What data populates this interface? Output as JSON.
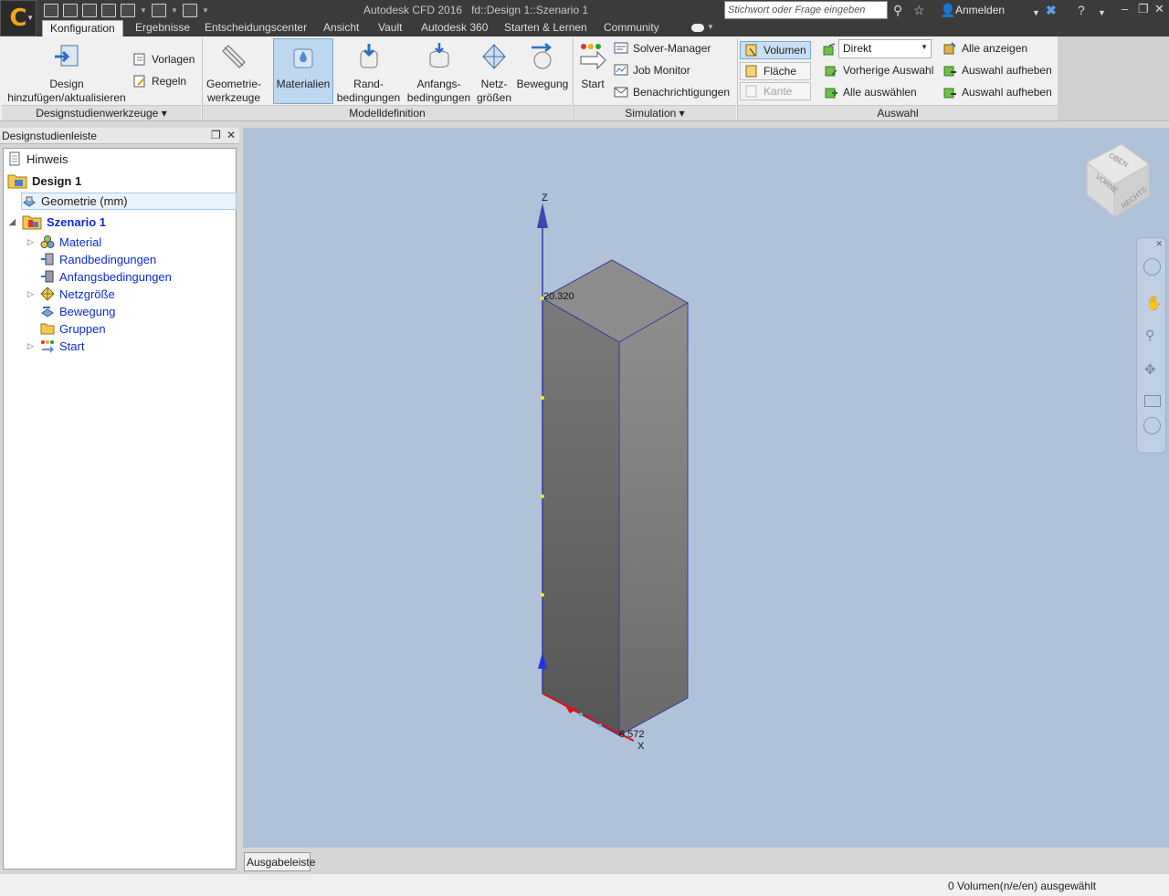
{
  "window": {
    "title": "Autodesk CFD 2016",
    "subtitle": "fd::Design 1::Szenario 1",
    "search_placeholder": "Stichwort oder Frage eingeben",
    "signin_label": "Anmelden"
  },
  "tabs": [
    "Konfiguration",
    "Ergebnisse",
    "Entscheidungscenter",
    "Ansicht",
    "Vault",
    "Autodesk 360",
    "Starten & Lernen",
    "Community"
  ],
  "ribbon": {
    "design_tools": {
      "add_design": "Design hinzufügen/aktualisieren",
      "add_design_l1": "Design",
      "add_design_l2": "hinzufügen/aktualisieren",
      "templates": "Vorlagen",
      "rules": "Regeln",
      "panel_label": "Designstudienwerkzeuge"
    },
    "model_def": {
      "geometry_tools_l1": "Geometrie-",
      "geometry_tools_l2": "werkzeuge",
      "materials": "Materialien",
      "boundary_l1": "Rand-",
      "boundary_l2": "bedingungen",
      "initial_l1": "Anfangs-",
      "initial_l2": "bedingungen",
      "mesh_l1": "Netz-",
      "mesh_l2": "größen",
      "motion": "Bewegung",
      "panel_label": "Modelldefinition"
    },
    "simulation": {
      "start": "Start",
      "solver_manager": "Solver-Manager",
      "job_monitor": "Job Monitor",
      "notifications": "Benachrichtigungen",
      "panel_label": "Simulation"
    },
    "selection": {
      "volume": "Volumen",
      "surface": "Fläche",
      "edge": "Kante",
      "mode": "Direkt",
      "previous": "Vorherige Auswahl",
      "select_all": "Alle auswählen",
      "show_all": "Alle anzeigen",
      "clear1": "Auswahl aufheben",
      "clear2": "Auswahl aufheben",
      "panel_label": "Auswahl"
    }
  },
  "sidebar": {
    "title": "Designstudienleiste",
    "items": [
      {
        "label": "Hinweis"
      },
      {
        "label": "Design 1"
      },
      {
        "label": "Geometrie (mm)"
      },
      {
        "label": "Szenario 1"
      },
      {
        "label": "Material"
      },
      {
        "label": "Randbedingungen"
      },
      {
        "label": "Anfangsbedingungen"
      },
      {
        "label": "Netzgröße"
      },
      {
        "label": "Bewegung"
      },
      {
        "label": "Gruppen"
      },
      {
        "label": "Start"
      }
    ]
  },
  "viewport": {
    "axis_z": "Z",
    "axis_x": "X",
    "dim_z": "20.320",
    "dim_x": "6.572",
    "viewcube": {
      "top": "OBEN",
      "front": "VORNE",
      "right": "RECHTS"
    }
  },
  "output_button": "Ausgabeleiste",
  "status": "0 Volumen(n/e/en) ausgewählt",
  "colors": {
    "titlebar": "#3b3b3b",
    "viewport_bg": "#b0c2da",
    "link": "#0a2bd6",
    "selected": "#bcd7f0"
  }
}
